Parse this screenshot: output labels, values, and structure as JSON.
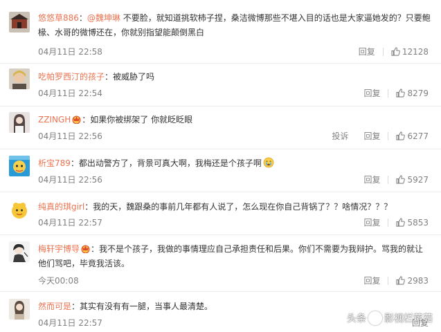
{
  "comments": [
    {
      "username": "悠悠草886",
      "separator": "：",
      "mention": "@魏坤琳",
      "text": " 不要脸，就知道挑软柿子捏，桑洁微博那些不堪入目的话也是大家逼她发的？只要鲍椽、水哥的微博还在，你就别指望能颠倒黑白",
      "time": "04月11日 22:58",
      "reply": "回复",
      "likes": "12128"
    },
    {
      "username": "吃帕罗西汀的孩子",
      "separator": "：",
      "text": "被威胁了吗",
      "time": "04月11日 22:54",
      "reply": "回复",
      "likes": "8279"
    },
    {
      "username": "ZZINGH",
      "separator": "：",
      "text": "如果你被绑架了 你就眨眨眼",
      "time": "04月11日 22:56",
      "report": "投诉",
      "reply": "回复",
      "likes": "6277"
    },
    {
      "username": "析宝789",
      "separator": "：",
      "text": "都出动警方了，背景可真大啊，我梅还是个孩子啊",
      "time": "04月11日 22:56",
      "reply": "回复",
      "likes": "5927"
    },
    {
      "username": "纯真的琪girl",
      "separator": "：",
      "text": "我的天，魏跟桑的事前几年都有人说了，怎么现在你自己背锅了？？啥情况？？？",
      "time": "04月11日 22:57",
      "reply": "回复",
      "likes": "5853"
    },
    {
      "username": "梅轩宇博导",
      "separator": "：",
      "text": "我不是个孩子，我做的事情理应自己承担责任和后果。你们不需要为我辩护。骂我的就让他们骂吧，毕竟我活该。",
      "time": "今天00:08",
      "reply": "回复",
      "likes": "2983"
    },
    {
      "username": "然而可是",
      "separator": "：",
      "text": "其实有没有有一腿，当事人最清楚。",
      "time": "04月11日 22:57",
      "reply": "回复",
      "likes": ""
    }
  ],
  "watermark": {
    "prefix": "头条",
    "suffix": "影视栏蒋茹"
  },
  "colors": {
    "username": "#eb7350",
    "meta": "#808080",
    "text": "#333333",
    "divider": "#ececec"
  },
  "icons": {
    "like": "thumbs-up-icon",
    "vip": "crown-badge-icon",
    "emoji": "crying-face-icon"
  }
}
